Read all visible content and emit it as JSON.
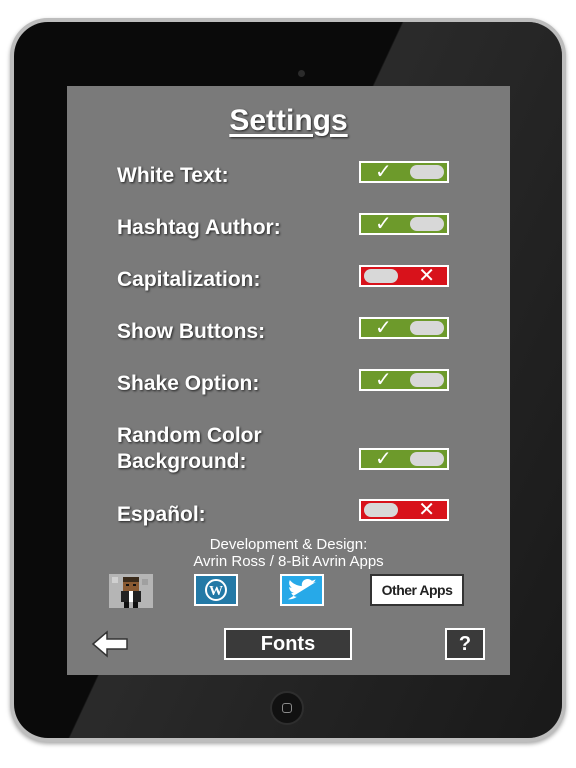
{
  "settings": {
    "title": "Settings",
    "items": [
      {
        "label": "White Text:",
        "state": "on",
        "mark": "✓"
      },
      {
        "label": "Hashtag Author:",
        "state": "on",
        "mark": "✓"
      },
      {
        "label": "Capitalization:",
        "state": "off",
        "mark": "✕"
      },
      {
        "label": "Show Buttons:",
        "state": "on",
        "mark": "✓"
      },
      {
        "label": "Shake Option:",
        "state": "on",
        "mark": "✓"
      },
      {
        "label_line1": "Random Color",
        "label_line2": "Background:",
        "state": "on",
        "mark": "✓"
      },
      {
        "label": "Español:",
        "state": "off",
        "mark": "✕"
      }
    ]
  },
  "credits": {
    "line1": "Development & Design:",
    "line2": "Avrin Ross / 8-Bit Avrin Apps"
  },
  "links": {
    "avatar_icon": "pixel-avatar-icon",
    "wordpress_icon": "wordpress-icon",
    "twitter_icon": "twitter-bird-icon",
    "other_apps_label": "Other Apps"
  },
  "footer": {
    "back_icon": "back-arrow-icon",
    "fonts_label": "Fonts",
    "help_label": "?"
  },
  "colors": {
    "toggle_on": "#6d9a2b",
    "toggle_off": "#d8121b",
    "screen_bg": "#7a7a7a"
  }
}
